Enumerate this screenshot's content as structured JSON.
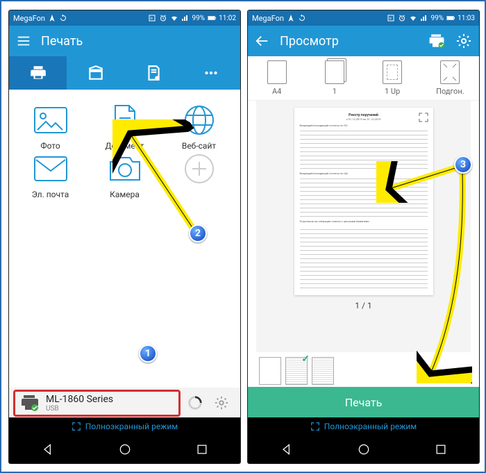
{
  "left": {
    "status": {
      "carrier": "MegaFon",
      "battery": "99%",
      "time": "11:02"
    },
    "appbar": {
      "title": "Печать"
    },
    "grid": {
      "photo": "Фото",
      "document": "Документ",
      "web": "Веб-сайт",
      "email": "Эл. почта",
      "camera": "Камера"
    },
    "printer": {
      "name": "ML-1860 Series",
      "connection": "USB"
    },
    "fullscreen": "Полноэкранный режим"
  },
  "right": {
    "status": {
      "carrier": "MegaFon",
      "battery": "99%",
      "time": "11:03"
    },
    "appbar": {
      "title": "Просмотр"
    },
    "options": {
      "size": "A4",
      "copies": "1",
      "layout": "1 Up",
      "fit": "Подгон."
    },
    "pagenum": "1 / 1",
    "printbtn": "Печать",
    "fullscreen": "Полноэкранный режим"
  },
  "badges": {
    "b1": "1",
    "b2": "2",
    "b3": "3"
  }
}
